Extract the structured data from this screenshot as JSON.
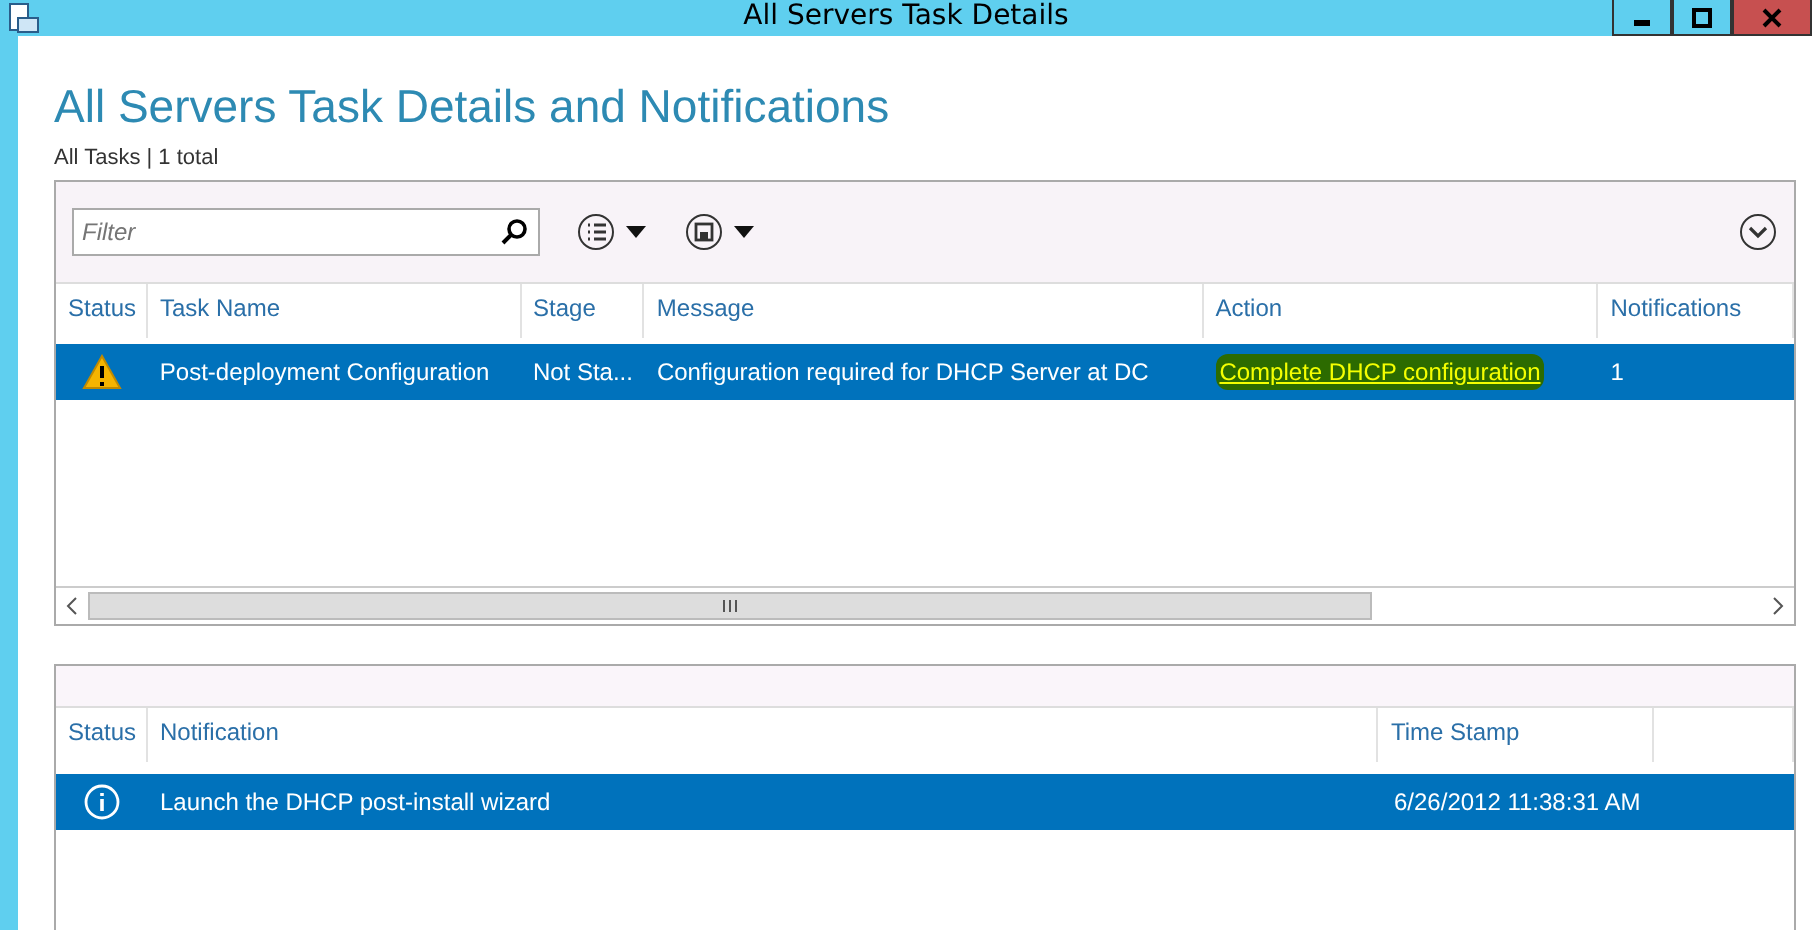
{
  "window": {
    "title": "All Servers Task Details"
  },
  "heading": "All Servers Task Details and Notifications",
  "subtitle": "All Tasks | 1 total",
  "filter": {
    "placeholder": "Filter"
  },
  "tasks": {
    "columns": [
      "Status",
      "Task Name",
      "Stage",
      "Message",
      "Action",
      "Notifications"
    ],
    "rows": [
      {
        "kind": "warning",
        "task": "Post-deployment Configuration",
        "stage": "Not Sta...",
        "message": "Configuration required for DHCP Server at DC",
        "action": "Complete DHCP configuration",
        "action_highlighted": true,
        "notifications": "1",
        "selected": true
      }
    ]
  },
  "notifications": {
    "columns": [
      "Status",
      "Notification",
      "Time Stamp"
    ],
    "rows": [
      {
        "kind": "info",
        "notification": "Launch the DHCP post-install wizard",
        "timestamp": "6/26/2012 11:38:31 AM",
        "selected": true
      }
    ]
  }
}
